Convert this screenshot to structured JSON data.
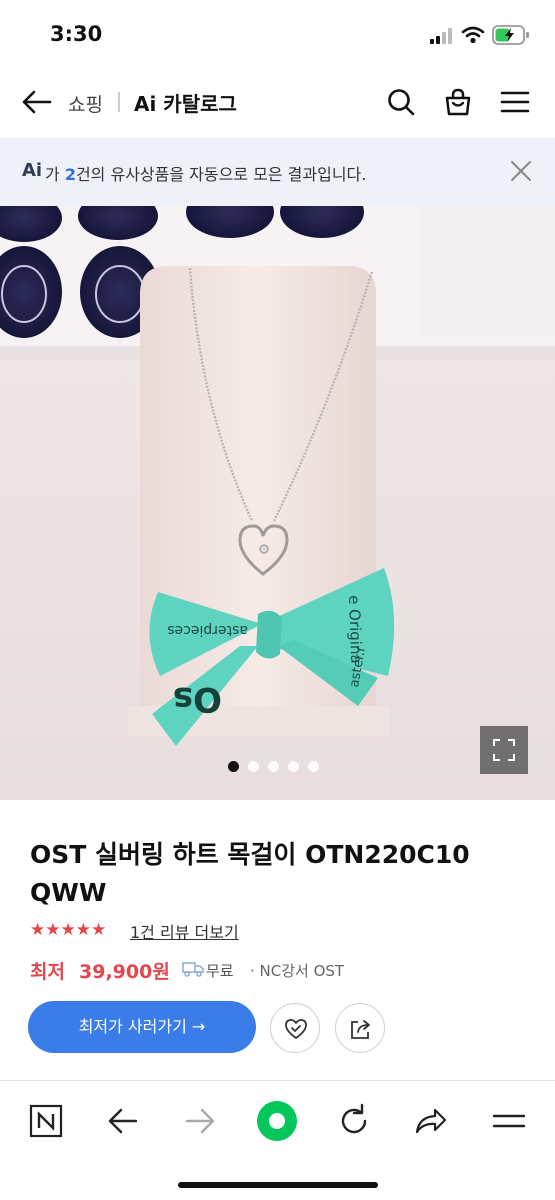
{
  "status": {
    "time": "3:30"
  },
  "nav": {
    "crumb": "쇼핑",
    "title": "Ai 카탈로그"
  },
  "banner": {
    "ai_mark": "Ai",
    "text_prefix": "가 ",
    "count": "2",
    "text_suffix": "건의 유사상품을 자동으로 모은 결과입니다."
  },
  "hero": {
    "ribbon_text_1": "e Origina",
    "ribbon_text_2": "asterpieces",
    "ribbon_text_3": "aster.r",
    "ribbon_text_4": "Os",
    "slide_count": 5,
    "active_slide": 1
  },
  "product": {
    "name": "OST 실버링 하트 목걸이 OTN220C10 QWW",
    "stars": "★★★★★",
    "rating": 5,
    "review": "1건 리뷰 더보기",
    "price_label": "최저",
    "price": "39,900원",
    "shipping": "무료",
    "seller": "· NC강서 OST"
  },
  "actions": {
    "buy_label": "최저가 사러가기 →"
  },
  "colors": {
    "accent": "#3b7de8",
    "price": "#e2474d",
    "ribbon": "#5ed3c0",
    "naver_green": "#03c75a"
  }
}
